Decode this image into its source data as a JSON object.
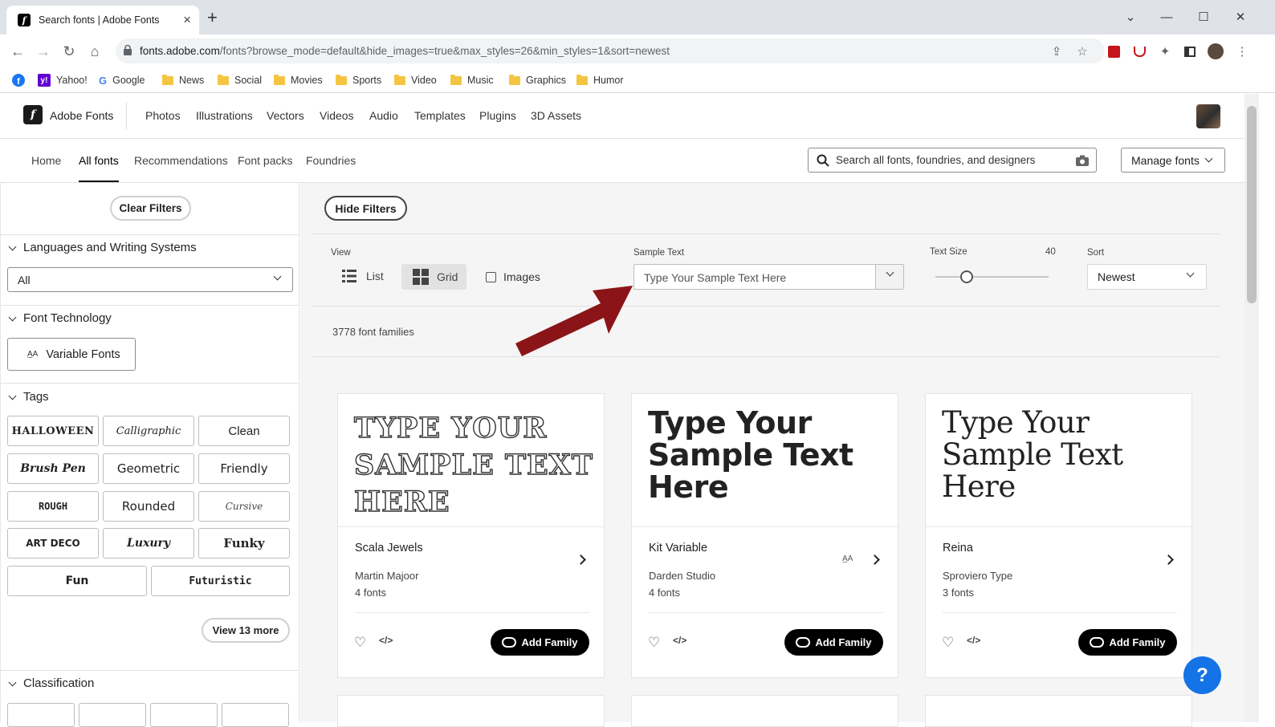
{
  "browser": {
    "tab_title": "Search fonts | Adobe Fonts",
    "url_host": "fonts.adobe.com",
    "url_path": "/fonts?browse_mode=default&hide_images=true&max_styles=26&min_styles=1&sort=newest",
    "bookmarks": [
      "Yahoo!",
      "Google",
      "News",
      "Social",
      "Movies",
      "Sports",
      "Video",
      "Music",
      "Graphics",
      "Humor"
    ]
  },
  "header": {
    "brand": "Adobe Fonts",
    "nav": [
      "Photos",
      "Illustrations",
      "Vectors",
      "Videos",
      "Audio",
      "Templates",
      "Plugins",
      "3D Assets"
    ]
  },
  "subnav": {
    "items": [
      "Home",
      "All fonts",
      "Recommendations",
      "Font packs",
      "Foundries"
    ],
    "active": "All fonts",
    "search_placeholder": "Search all fonts, foundries, and designers",
    "manage_label": "Manage fonts"
  },
  "sidebar": {
    "clear_filters": "Clear Filters",
    "languages_title": "Languages and Writing Systems",
    "languages_value": "All",
    "tech_title": "Font Technology",
    "variable_label": "Variable Fonts",
    "tags_title": "Tags",
    "tags": [
      "HALLOWEEN",
      "Calligraphic",
      "Clean",
      "Brush Pen",
      "Geometric",
      "Friendly",
      "ROUGH",
      "Rounded",
      "Cursive",
      "ART DECO",
      "Luxury",
      "Funky",
      "Fun",
      "Futuristic"
    ],
    "view_more": "View 13 more",
    "classification_title": "Classification"
  },
  "controls": {
    "hide_filters": "Hide Filters",
    "view_label": "View",
    "list_label": "List",
    "grid_label": "Grid",
    "images_label": "Images",
    "sample_label": "Sample Text",
    "sample_placeholder": "Type Your Sample Text Here",
    "size_label": "Text Size",
    "size_value": "40",
    "size_fraction": 0.28,
    "sort_label": "Sort",
    "sort_value": "Newest"
  },
  "results_count": "3778 font families",
  "cards": [
    {
      "sample": "TYPE YOUR SAMPLE TEXT HERE",
      "name": "Scala Jewels",
      "foundry": "Martin Majoor",
      "count": "4 fonts",
      "variable": false
    },
    {
      "sample": "Type Your Sample Text Here",
      "name": "Kit Variable",
      "foundry": "Darden Studio",
      "count": "4 fonts",
      "variable": true
    },
    {
      "sample": "Type Your Sample Text Here",
      "name": "Reina",
      "foundry": "Sproviero Type",
      "count": "3 fonts",
      "variable": false
    }
  ],
  "add_family": "Add Family",
  "help": "?",
  "colors": {
    "accent": "#1473e6",
    "arrow": "#8b1418"
  }
}
